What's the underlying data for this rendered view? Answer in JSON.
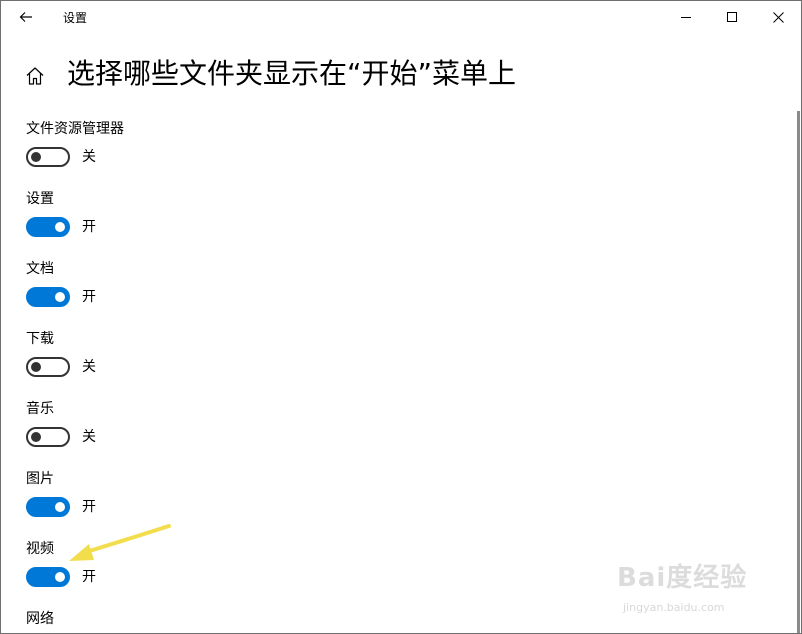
{
  "window": {
    "title": "设置"
  },
  "header": {
    "page_title": "选择哪些文件夹显示在“开始”菜单上"
  },
  "settings": [
    {
      "label": "文件资源管理器",
      "state": "关",
      "on": false
    },
    {
      "label": "设置",
      "state": "开",
      "on": true
    },
    {
      "label": "文档",
      "state": "开",
      "on": true
    },
    {
      "label": "下载",
      "state": "关",
      "on": false
    },
    {
      "label": "音乐",
      "state": "关",
      "on": false
    },
    {
      "label": "图片",
      "state": "开",
      "on": true
    },
    {
      "label": "视频",
      "state": "开",
      "on": true
    },
    {
      "label": "网络"
    }
  ],
  "colors": {
    "accent": "#0078d7",
    "annotation_arrow": "#f2de4d"
  },
  "watermark": {
    "logo_text": "Bai度经验",
    "url": "jingyan.baidu.com"
  }
}
